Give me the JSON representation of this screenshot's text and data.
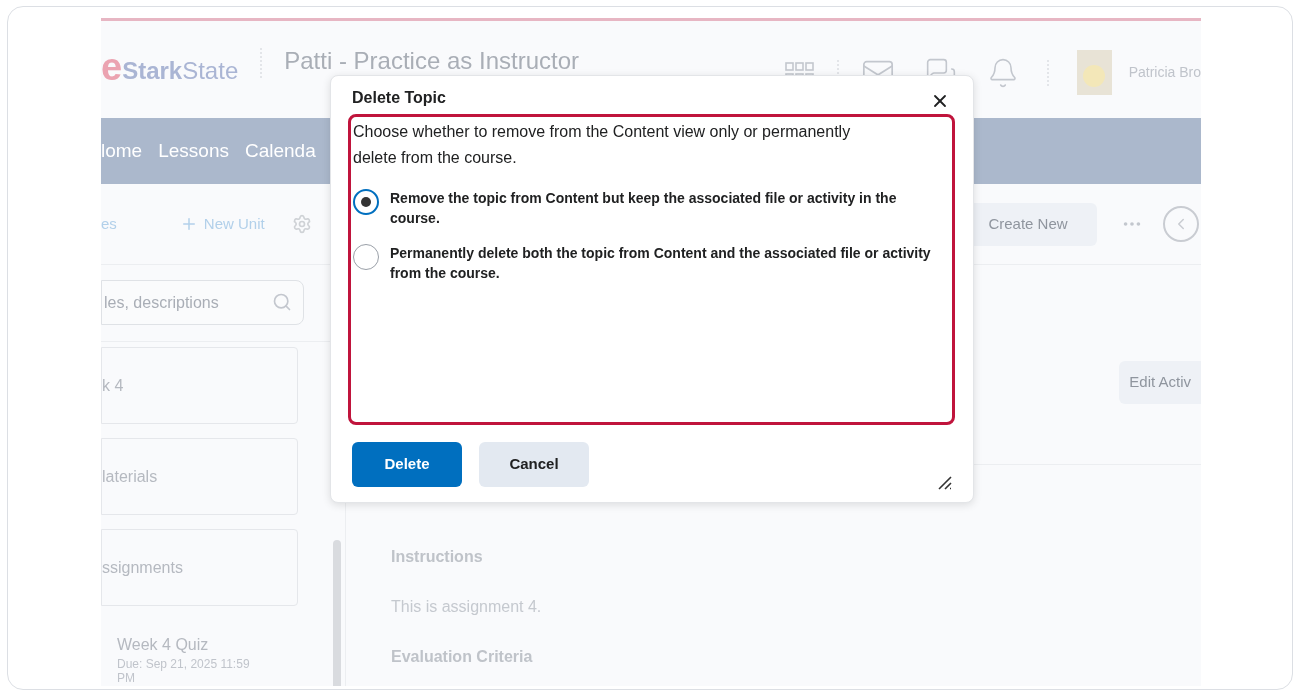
{
  "header": {
    "logo_mark": "e",
    "logo_text": "**Stark**State",
    "course_title": "Patti - Practice as Instructor",
    "user_name": "Patricia Bro"
  },
  "nav": [
    "lome",
    "Lessons",
    "Calenda"
  ],
  "toolbar": {
    "left_link": "es",
    "new_unit": "New Unit",
    "create_new": "Create New"
  },
  "sidebar": {
    "search_placeholder": "les, descriptions",
    "items": [
      "k 4",
      "laterials",
      "ssignments"
    ],
    "quiz": {
      "title": "Week 4 Quiz",
      "due": "Due: Sep 21, 2025 11:59 PM"
    }
  },
  "content": {
    "edit_button": "Edit Activ",
    "sections": [
      {
        "kind": "heading",
        "text": "Instructions"
      },
      {
        "kind": "body",
        "text": "This is assignment 4."
      },
      {
        "kind": "heading",
        "text": "Evaluation Criteria"
      }
    ]
  },
  "dialog": {
    "title": "Delete Topic",
    "description": "Choose whether to remove from the Content view only or permanently delete from the course.",
    "options": [
      {
        "label": "Remove the topic from Content but keep the associated file or activity in the course.",
        "selected": true
      },
      {
        "label": "Permanently delete both the topic from Content and the associated file or activity from the course.",
        "selected": false
      }
    ],
    "buttons": [
      {
        "label": "Delete",
        "kind": "primary"
      },
      {
        "label": "Cancel",
        "kind": "secondary"
      }
    ]
  }
}
